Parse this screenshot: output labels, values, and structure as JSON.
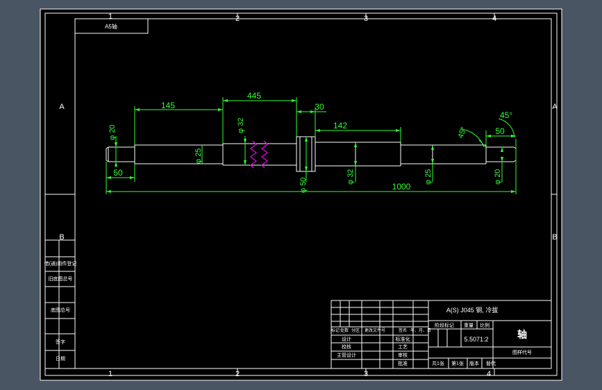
{
  "viewport": {
    "background_color": "#4a5564",
    "sheet_color": "#000000"
  },
  "colors": {
    "geometry": "#ffffff",
    "dimension": "#33ff33",
    "break_mark": "#e000e0"
  },
  "zone_labels": {
    "col_top": [
      "1",
      "2",
      "3",
      "4"
    ],
    "col_bottom": [
      "1",
      "2",
      "3",
      "4"
    ],
    "row_left": [
      "A",
      "B"
    ],
    "row_right": [
      "A",
      "B"
    ]
  },
  "drawing_code_box": {
    "text": "A5轴"
  },
  "dimensions": {
    "len_145": "145",
    "len_445": "445",
    "len_30": "30",
    "len_142": "142",
    "len_50_left": "50",
    "len_1000": "1000",
    "len_50_right": "50",
    "dia_20_left": "φ 20",
    "dia_25_left": "φ 25",
    "dia_32_top": "φ 32",
    "dia_50": "φ 50",
    "dia_32_bottom": "φ 32",
    "dia_25_right": "φ 25",
    "dia_20_right": "φ 20",
    "chamfer_angle_1": "45°",
    "chamfer_angle_2": "45°"
  },
  "side_panel": {
    "entries": [
      "借(通)用件登记",
      "旧底图总号",
      "底图总号",
      "签字",
      "日期"
    ]
  },
  "title_block": {
    "material": "A(S) J045 钢, 冷拔",
    "part_name": "轴",
    "scale_value": "5.5071:2",
    "drawing_number": "图样代号",
    "header_row": [
      "标记",
      "处数",
      "分区",
      "更改文件号",
      "签名",
      "年、月、日"
    ],
    "stage_labels": [
      "阶段标记",
      "重量",
      "比例"
    ],
    "rows": [
      {
        "left": "设计",
        "mid": "标准化"
      },
      {
        "left": "校核",
        "mid": "工艺"
      },
      {
        "left": "主管设计",
        "mid": "审核"
      },
      {
        "left": "",
        "mid": "批准"
      }
    ],
    "sheet_info": [
      "共1张",
      "第1张",
      "版本",
      "替代"
    ]
  }
}
